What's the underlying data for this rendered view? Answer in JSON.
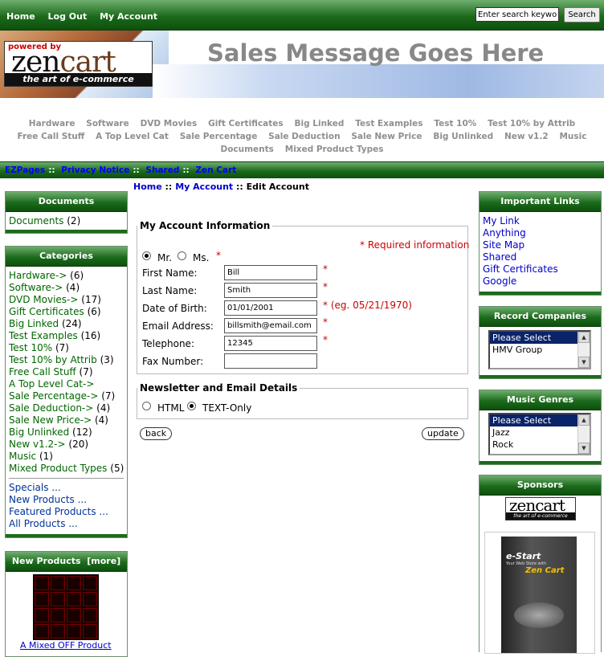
{
  "topbar": {
    "links": [
      "Home",
      "Log Out",
      "My Account"
    ],
    "search_placeholder": "Enter search keyword",
    "search_button": "Search"
  },
  "header": {
    "logo_powered": "powered by",
    "logo_brand_a": "zen",
    "logo_brand_b": "cart",
    "logo_tagline": "the art of e-commerce",
    "sales_message": "Sales Message Goes Here"
  },
  "category_menu": {
    "row1": [
      "Hardware",
      "Software",
      "DVD Movies",
      "Gift Certificates",
      "Big Linked",
      "Test Examples",
      "Test 10%",
      "Test 10% by Attrib"
    ],
    "row2": [
      "Free Call Stuff",
      "A Top Level Cat",
      "Sale Percentage",
      "Sale Deduction",
      "Sale New Price",
      "Big Unlinked",
      "New v1.2",
      "Music"
    ],
    "row3": [
      "Documents",
      "Mixed Product Types"
    ]
  },
  "ezpages": {
    "links": [
      "EZPages",
      "Privacy Notice",
      "Shared",
      "Zen Cart"
    ],
    "separator": "::"
  },
  "left": {
    "documents": {
      "title": "Documents",
      "items": [
        {
          "label": "Documents",
          "count": "(2)"
        }
      ]
    },
    "categories": {
      "title": "Categories",
      "items": [
        {
          "label": "Hardware->",
          "count": "(6)"
        },
        {
          "label": "Software->",
          "count": "(4)"
        },
        {
          "label": "DVD Movies->",
          "count": "(17)"
        },
        {
          "label": "Gift Certificates",
          "count": "(6)"
        },
        {
          "label": "Big Linked",
          "count": "(24)"
        },
        {
          "label": "Test Examples",
          "count": "(16)"
        },
        {
          "label": "Test 10%",
          "count": "(7)"
        },
        {
          "label": "Test 10% by Attrib",
          "count": "(3)"
        },
        {
          "label": "Free Call Stuff",
          "count": "(7)"
        },
        {
          "label": "A Top Level Cat->",
          "count": ""
        },
        {
          "label": "Sale Percentage->",
          "count": "(7)"
        },
        {
          "label": "Sale Deduction->",
          "count": "(4)"
        },
        {
          "label": "Sale New Price->",
          "count": "(4)"
        },
        {
          "label": "Big Unlinked",
          "count": "(12)"
        },
        {
          "label": "New v1.2->",
          "count": "(20)"
        },
        {
          "label": "Music",
          "count": "(1)"
        },
        {
          "label": "Mixed Product Types",
          "count": "(5)"
        }
      ],
      "extra": [
        "Specials ...",
        "New Products ...",
        "Featured Products ...",
        "All Products ..."
      ]
    },
    "new_products": {
      "title": "New Products",
      "more": "[more]",
      "product": "A Mixed OFF Product"
    }
  },
  "main": {
    "breadcrumb": [
      "Home",
      "My Account",
      "Edit Account"
    ],
    "breadcrumb_sep": "::",
    "account_legend": "My Account Information",
    "required_note": "* Required information",
    "salutation": {
      "mr": "Mr.",
      "ms": "Ms.",
      "selected": "Mr."
    },
    "star": "*",
    "fields": [
      {
        "label": "First Name:",
        "value": "Bill",
        "required": "*"
      },
      {
        "label": "Last Name:",
        "value": "Smith",
        "required": "*"
      },
      {
        "label": "Date of Birth:",
        "value": "01/01/2001",
        "required": "* (eg. 05/21/1970)"
      },
      {
        "label": "Email Address:",
        "value": "billsmith@email.com",
        "required": "*"
      },
      {
        "label": "Telephone:",
        "value": "12345",
        "required": "*"
      },
      {
        "label": "Fax Number:",
        "value": "",
        "required": ""
      }
    ],
    "newsletter_legend": "Newsletter and Email Details",
    "format": {
      "html": "HTML",
      "text": "TEXT-Only",
      "selected": "TEXT-Only"
    },
    "back_button": "back",
    "update_button": "update"
  },
  "right": {
    "important_links": {
      "title": "Important Links",
      "items": [
        "My Link",
        "Anything",
        "Site Map",
        "Shared",
        "Gift Certificates",
        "Google"
      ]
    },
    "record_companies": {
      "title": "Record Companies",
      "options": [
        "Please Select",
        "HMV Group"
      ]
    },
    "music_genres": {
      "title": "Music Genres",
      "options": [
        "Please Select",
        "Jazz",
        "Rock"
      ]
    },
    "sponsors": {
      "title": "Sponsors",
      "logo_a": "zen",
      "logo_b": "cart",
      "logo_tagline": "the art of e-commerce",
      "book_title": "e-Start",
      "book_sub": "Your Web Store with",
      "book_brand": "Zen Cart"
    }
  },
  "colors": {
    "bar_green": "#1c6b1c",
    "link_green": "#006600",
    "link_blue": "#0000cc",
    "required_red": "#cc0000"
  }
}
